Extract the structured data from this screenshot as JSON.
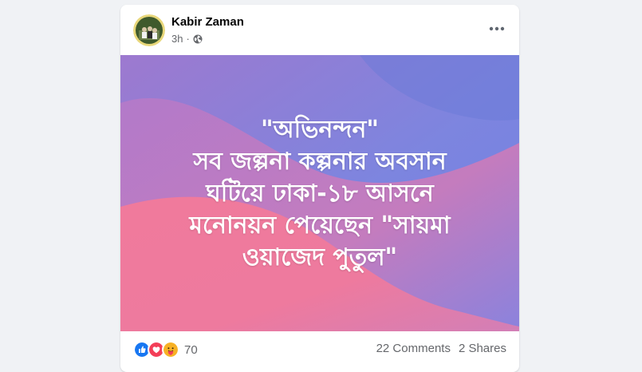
{
  "post": {
    "author": "Kabir Zaman",
    "time": "3h",
    "separator": "·",
    "privacy_icon": "globe-icon",
    "more_icon": "more-options-icon",
    "image_text": {
      "line1": "\"অভিনন্দন\"",
      "line2": "সব জল্পনা কল্পনার অবসান",
      "line3": "ঘটিয়ে ঢাকা-১৮ আসনে",
      "line4": "মনোনয়ন পেয়েছেন \"সায়মা",
      "line5": "ওয়াজেদ পুতুল\""
    },
    "reactions": {
      "icons": [
        "like-icon",
        "love-icon",
        "care-icon"
      ],
      "count": "70"
    },
    "comments": "22 Comments",
    "shares": "2 Shares"
  },
  "colors": {
    "page_bg": "#f0f2f5",
    "card_bg": "#ffffff",
    "like": "#1877f2",
    "love": "#f33e58",
    "care": "#f7b125",
    "muted_text": "#65676b"
  }
}
